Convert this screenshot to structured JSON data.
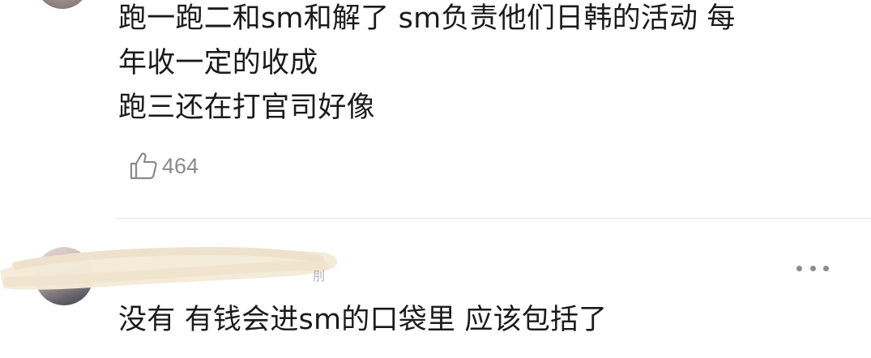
{
  "comments": [
    {
      "lines": [
        "跑一跑二和sm和解了 sm负责他们日韩的活动 每",
        "年收一定的收成",
        "跑三还在打官司好像"
      ],
      "like_count": "464"
    },
    {
      "username_visible_fragment": "刖",
      "text": "没有 有钱会进sm的口袋里 应该包括了"
    }
  ],
  "icons": {
    "like": "thumbs-up-outline-icon",
    "more": "more-horizontal-icon"
  },
  "colors": {
    "text": "#1b1b1b",
    "secondary": "#8a8a8a",
    "divider": "#e4e4e4",
    "redaction": "#f4ead8"
  }
}
